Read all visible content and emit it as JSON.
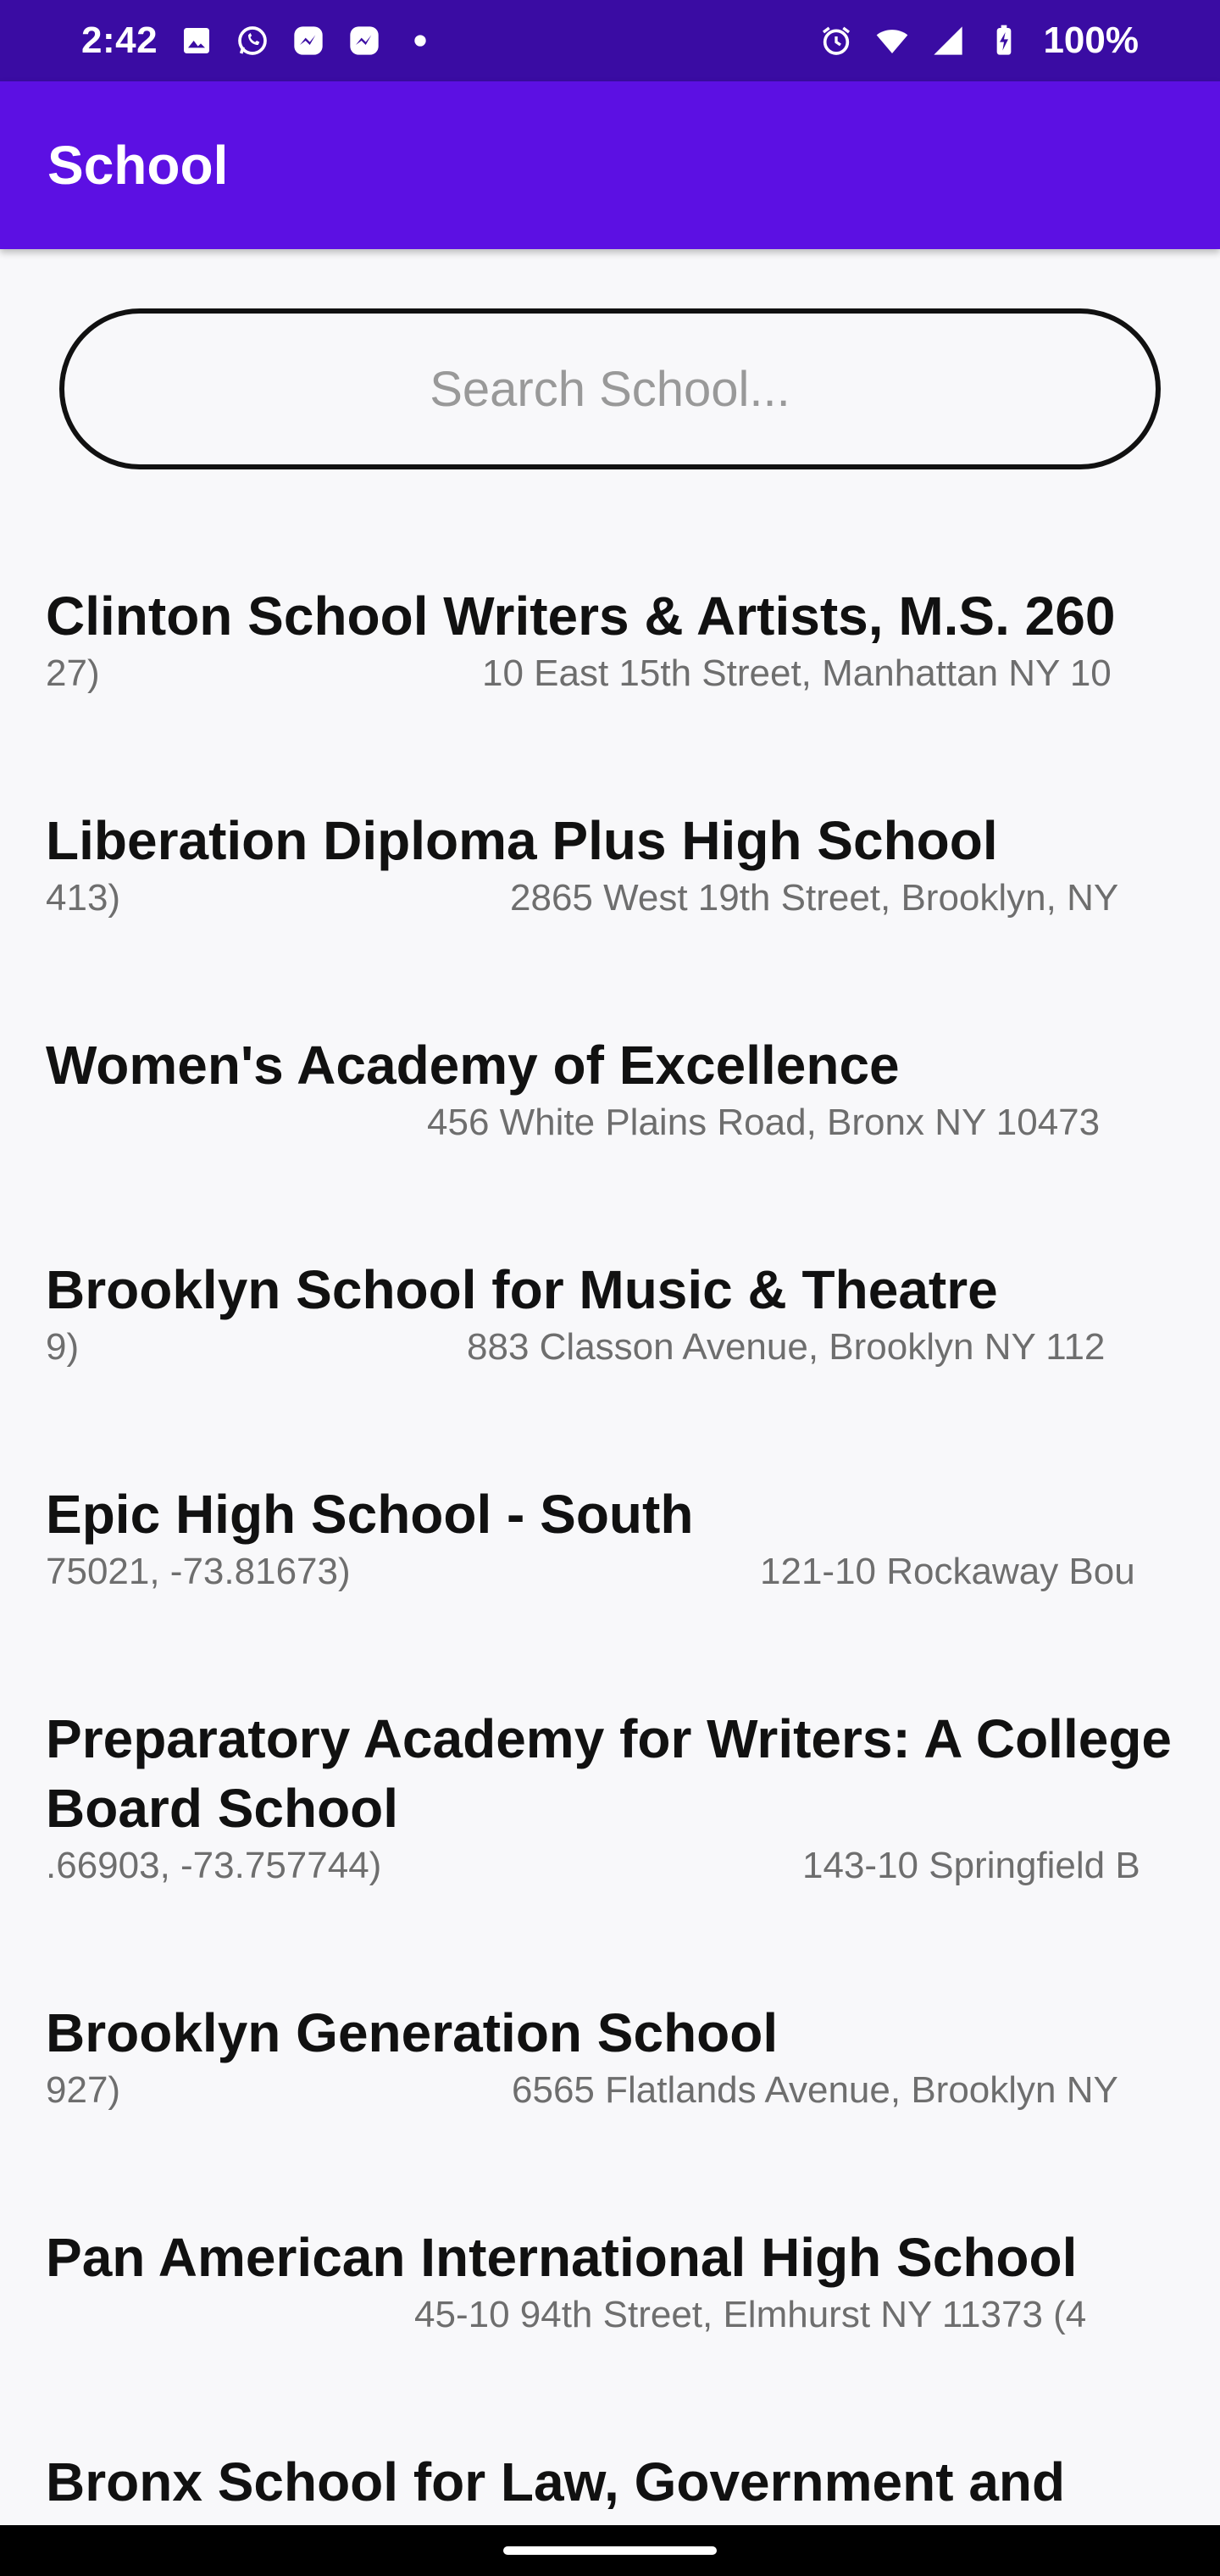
{
  "status_bar": {
    "time": "2:42",
    "battery": "100%",
    "icons_left": [
      "image-icon",
      "whatsapp-icon",
      "messenger-icon",
      "messenger-icon",
      "dot-icon"
    ],
    "icons_right": [
      "alarm-icon",
      "wifi-icon",
      "signal-icon",
      "battery-charging-icon"
    ]
  },
  "app_bar": {
    "title": "School"
  },
  "search": {
    "placeholder": "Search School...",
    "value": ""
  },
  "schools": [
    {
      "name": "Clinton School Writers & Artists, M.S. 260",
      "meta_left": "27)",
      "address": "10 East 15th Street, Manhattan NY 10"
    },
    {
      "name": "Liberation Diploma Plus High School",
      "meta_left": "413)",
      "address": "2865 West 19th Street, Brooklyn, NY"
    },
    {
      "name": "Women's Academy of Excellence",
      "meta_left": "",
      "address": "456 White Plains Road, Bronx NY 10473"
    },
    {
      "name": "Brooklyn School for Music & Theatre",
      "meta_left": "9)",
      "address": "883 Classon Avenue, Brooklyn NY 112"
    },
    {
      "name": "Epic High School - South",
      "meta_left": "75021, -73.81673)",
      "address": "121-10 Rockaway Bou"
    },
    {
      "name": "Preparatory Academy for Writers: A College Board School",
      "meta_left": ".66903, -73.757744)",
      "address": "143-10 Springfield B"
    },
    {
      "name": "Brooklyn Generation School",
      "meta_left": "927)",
      "address": "6565 Flatlands Avenue, Brooklyn NY"
    },
    {
      "name": "Pan American International High School",
      "meta_left": "",
      "address": "45-10 94th Street, Elmhurst NY 11373 (4"
    },
    {
      "name": "Bronx School for Law, Government and",
      "meta_left": "",
      "address": ""
    }
  ]
}
